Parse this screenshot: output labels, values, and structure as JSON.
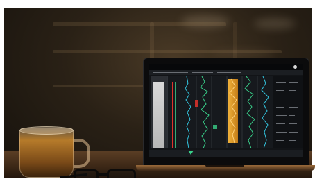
{
  "scene": {
    "colors": {
      "background": "#15110c",
      "table": "#5a3e24",
      "screen": "#121417",
      "gamma_ray": "#f0b13a",
      "curve_green": "#39d08a",
      "curve_cyan": "#33c6e0",
      "highlight_red": "#e0332b"
    },
    "objects": [
      "glass-tea-mug",
      "eyeglasses",
      "laptop",
      "bookshelf-background"
    ]
  },
  "laptop_screen": {
    "logo": "",
    "panels": [
      "left-log-panel",
      "depth-track",
      "curve-tracks",
      "gamma-track",
      "right-data-table"
    ]
  }
}
